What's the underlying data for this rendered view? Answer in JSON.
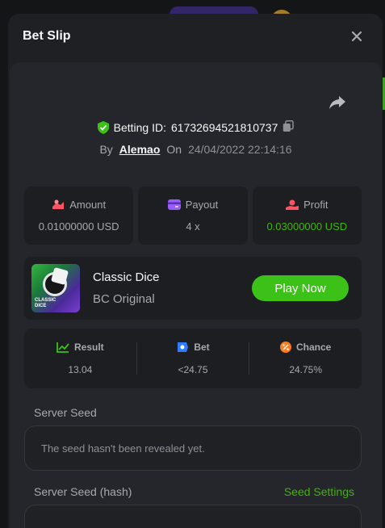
{
  "modal": {
    "title": "Bet Slip"
  },
  "bet": {
    "betting_id_label": "Betting ID:",
    "betting_id": "61732694521810737",
    "by_label": "By",
    "user": "Alemao",
    "on_label": "On",
    "date": "24/04/2022 22:14:16"
  },
  "stats": {
    "amount_label": "Amount",
    "amount_value": "0.01000000 USD",
    "payout_label": "Payout",
    "payout_value": "4 x",
    "profit_label": "Profit",
    "profit_value": "0.03000000 USD"
  },
  "game": {
    "name": "Classic Dice",
    "provider": "BC Original",
    "thumb_text_line1": "CLASSIC",
    "thumb_text_line2": "DICE",
    "play_label": "Play Now"
  },
  "results": {
    "result_label": "Result",
    "result_value": "13.04",
    "bet_label": "Bet",
    "bet_value": "<24.75",
    "chance_label": "Chance",
    "chance_value": "24.75%"
  },
  "seeds": {
    "server_seed_label": "Server Seed",
    "server_seed_value": "The seed hasn't been revealed yet.",
    "server_seed_hash_label": "Server Seed (hash)",
    "seed_settings_label": "Seed Settings"
  },
  "colors": {
    "accent": "#43b309",
    "button": "#3bc117",
    "background": "#24262b"
  },
  "icons": [
    "close-icon",
    "share-icon",
    "shield-check-icon",
    "copy-icon",
    "coins-icon",
    "wallet-icon",
    "profit-icon",
    "result-icon",
    "bet-icon",
    "chance-icon"
  ]
}
